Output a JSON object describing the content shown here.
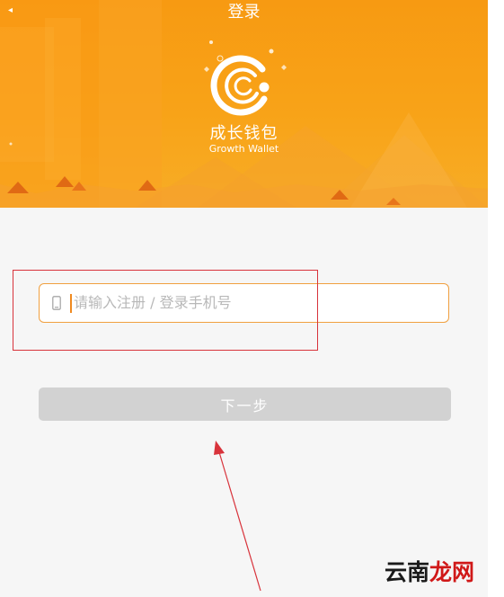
{
  "nav": {
    "title": "登录",
    "back_icon": "chevron-left-icon"
  },
  "brand": {
    "name": "成长钱包",
    "subtitle": "Growth Wallet",
    "logo_icon": "crescent-logo-icon"
  },
  "form": {
    "phone_placeholder": "请输入注册 / 登录手机号",
    "phone_value": "",
    "phone_icon": "mobile-phone-icon",
    "next_label": "下一步"
  },
  "watermark": {
    "text_dark": "云南",
    "text_red": "龙网"
  },
  "colors": {
    "header_orange": "#f79a12",
    "input_border": "#f0a040",
    "caret": "#f08a20",
    "button_disabled": "#d2d2d2",
    "annotation_red": "#d8333b",
    "page_bg": "#f6f6f6"
  }
}
